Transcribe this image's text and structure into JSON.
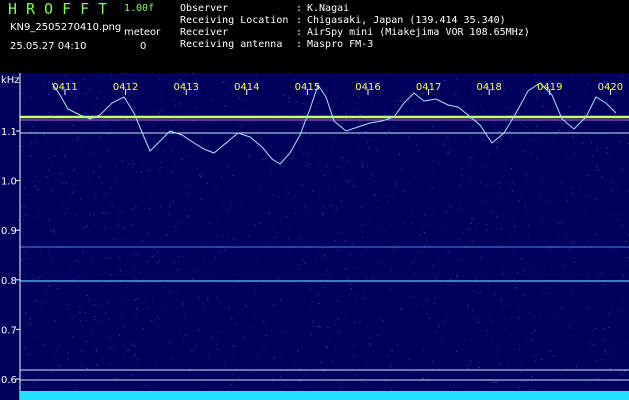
{
  "header": {
    "app_title": "HROFFT",
    "version": "1.00f",
    "filename": "KN9_2505270410.png",
    "datetime": "25.05.27 04:10",
    "meteor_label": "meteor",
    "meteor_count": "0"
  },
  "info": [
    {
      "label": "Observer",
      "value": "K.Nagai"
    },
    {
      "label": "Receiving Location",
      "value": "Chigasaki, Japan (139.414 35.340)"
    },
    {
      "label": "Receiver",
      "value": "AirSpy mini (Miakejima VOR 108.65MHz)"
    },
    {
      "label": "Receiving antenna",
      "value": "Maspro FM-3"
    }
  ],
  "spectrogram": {
    "unit": "kHz",
    "y_ticks": [
      "1.1",
      "1.0",
      "0.9",
      "0.8",
      "0.7",
      "0.6"
    ],
    "time_ticks": [
      "0411",
      "0412",
      "0413",
      "0414",
      "0415",
      "0416",
      "0417",
      "0418",
      "0419",
      "0420"
    ],
    "colors": {
      "axis": "#ffffff",
      "tick_label": "#ffff55",
      "carrier": "#ccff66",
      "trace": "#9fe8ff",
      "noise_floor": "#22e0ff"
    }
  }
}
